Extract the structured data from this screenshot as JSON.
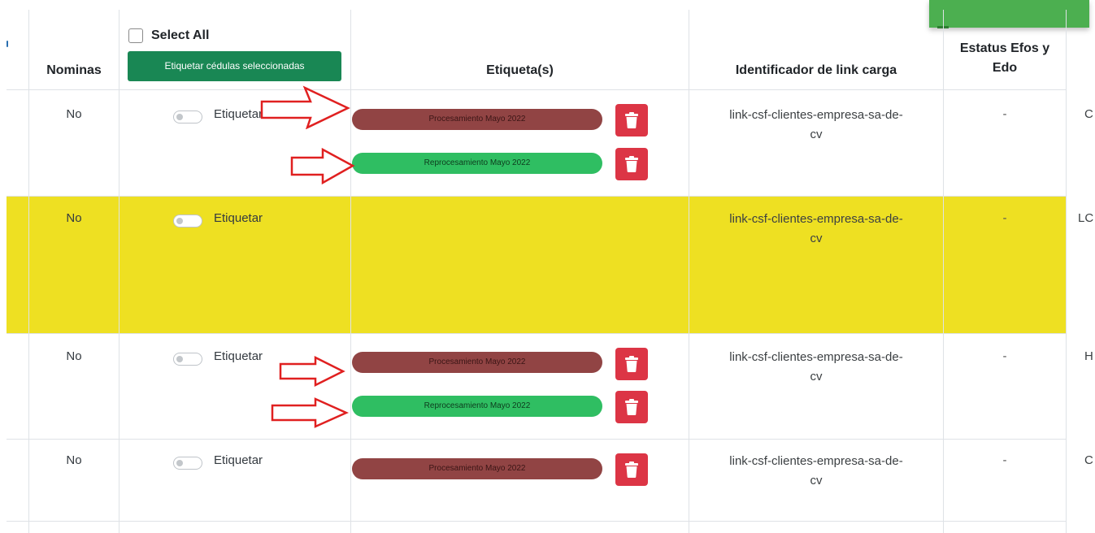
{
  "header": {
    "nominas": "Nominas",
    "select_all": "Select All",
    "tag_selected_button": "Etiquetar cédulas seleccionadas",
    "etiquetas": "Etiqueta(s)",
    "identificador": "Identificador de link carga",
    "estatus_line1": "Estatus Efos y",
    "estatus_line2": "Edo"
  },
  "colors": {
    "highlight_row": "#eee022",
    "tag_procesamiento": "#914444",
    "tag_reprocesamiento": "#2fbe62",
    "delete_button": "#dc3545",
    "primary_button": "#198754",
    "arrow": "#e02020"
  },
  "icons": {
    "delete": "trash-icon",
    "pointer": "arrow-right-outline-icon"
  },
  "rows": [
    {
      "nominas": "No",
      "toggle_label": "Etiquetar",
      "tags": [
        "Procesamiento Mayo 2022",
        "Reprocesamiento Mayo 2022"
      ],
      "link_line1": "link-csf-clientes-empresa-sa-de-",
      "link_line2": "cv",
      "estatus": "-",
      "next_col": "C"
    },
    {
      "nominas": "No",
      "toggle_label": "Etiquetar",
      "tags": [],
      "link_line1": "link-csf-clientes-empresa-sa-de-",
      "link_line2": "cv",
      "estatus": "-",
      "next_col": "LC"
    },
    {
      "nominas": "No",
      "toggle_label": "Etiquetar",
      "tags": [
        "Procesamiento Mayo 2022",
        "Reprocesamiento Mayo 2022"
      ],
      "link_line1": "link-csf-clientes-empresa-sa-de-",
      "link_line2": "cv",
      "estatus": "-",
      "next_col": "H"
    },
    {
      "nominas": "No",
      "toggle_label": "Etiquetar",
      "tags": [
        "Procesamiento Mayo 2022"
      ],
      "link_line1": "link-csf-clientes-empresa-sa-de-",
      "link_line2": "cv",
      "estatus": "-",
      "next_col": "C"
    }
  ]
}
